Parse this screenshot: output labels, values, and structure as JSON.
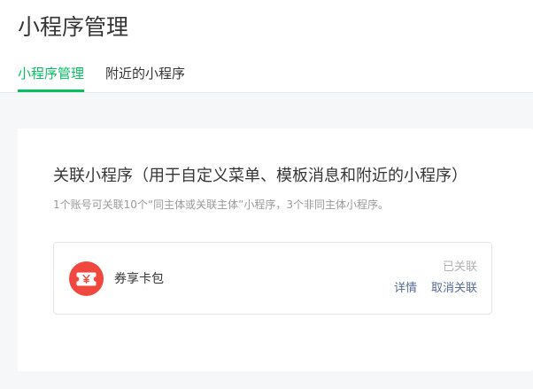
{
  "page": {
    "title": "小程序管理"
  },
  "tabs": [
    {
      "label": "小程序管理",
      "active": true
    },
    {
      "label": "附近的小程序",
      "active": false
    }
  ],
  "section": {
    "title": "关联小程序（用于自定义菜单、模板消息和附近的小程序）",
    "description": "1个账号可关联10个“同主体或关联主体”小程序，3个非同主体小程序。"
  },
  "linked_app": {
    "icon": "coupon-ticket-icon",
    "name": "券享卡包",
    "status": "已关联",
    "details_label": "详情",
    "unlink_label": "取消关联"
  },
  "colors": {
    "accent": "#07c160",
    "link": "#576b95",
    "icon_bg": "#f0473e"
  }
}
